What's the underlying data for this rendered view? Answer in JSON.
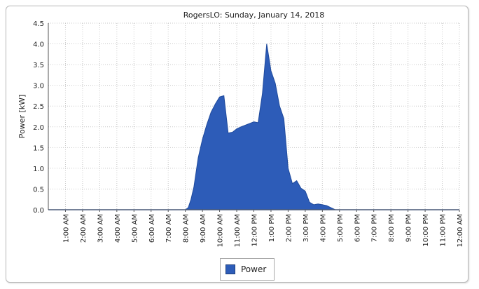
{
  "colors": {
    "series_fill": "#2d5cb8",
    "series_stroke": "#1f4a9c",
    "grid": "#c9c9c9",
    "axis": "#555555",
    "text": "#222222"
  },
  "chart_data": {
    "type": "area",
    "title": "RogersLO: Sunday, January 14, 2018",
    "xlabel": "",
    "ylabel": "Power [kW]",
    "ylim": [
      0,
      4.5
    ],
    "y_ticks": [
      "0.0",
      "0.5",
      "1.0",
      "1.5",
      "2.0",
      "2.5",
      "3.0",
      "3.5",
      "4.0",
      "4.5"
    ],
    "x_range_hours": [
      0,
      24
    ],
    "x_ticks": [
      {
        "hour": 1,
        "label": "1:00 AM"
      },
      {
        "hour": 2,
        "label": "2:00 AM"
      },
      {
        "hour": 3,
        "label": "3:00 AM"
      },
      {
        "hour": 4,
        "label": "4:00 AM"
      },
      {
        "hour": 5,
        "label": "5:00 AM"
      },
      {
        "hour": 6,
        "label": "6:00 AM"
      },
      {
        "hour": 7,
        "label": "7:00 AM"
      },
      {
        "hour": 8,
        "label": "8:00 AM"
      },
      {
        "hour": 9,
        "label": "9:00 AM"
      },
      {
        "hour": 10,
        "label": "10:00 AM"
      },
      {
        "hour": 11,
        "label": "11:00 AM"
      },
      {
        "hour": 12,
        "label": "12:00 PM"
      },
      {
        "hour": 13,
        "label": "1:00 PM"
      },
      {
        "hour": 14,
        "label": "2:00 PM"
      },
      {
        "hour": 15,
        "label": "3:00 PM"
      },
      {
        "hour": 16,
        "label": "4:00 PM"
      },
      {
        "hour": 17,
        "label": "5:00 PM"
      },
      {
        "hour": 18,
        "label": "6:00 PM"
      },
      {
        "hour": 19,
        "label": "7:00 PM"
      },
      {
        "hour": 20,
        "label": "8:00 PM"
      },
      {
        "hour": 21,
        "label": "9:00 PM"
      },
      {
        "hour": 22,
        "label": "10:00 PM"
      },
      {
        "hour": 23,
        "label": "11:00 PM"
      },
      {
        "hour": 24,
        "label": "12:00 AM"
      }
    ],
    "grid": true,
    "legend_position": "bottom-center",
    "series": [
      {
        "name": "Power",
        "points": [
          {
            "hour": 0.0,
            "kw": 0.0
          },
          {
            "hour": 8.0,
            "kw": 0.0
          },
          {
            "hour": 8.17,
            "kw": 0.05
          },
          {
            "hour": 8.33,
            "kw": 0.25
          },
          {
            "hour": 8.5,
            "kw": 0.55
          },
          {
            "hour": 8.75,
            "kw": 1.25
          },
          {
            "hour": 9.0,
            "kw": 1.7
          },
          {
            "hour": 9.25,
            "kw": 2.05
          },
          {
            "hour": 9.5,
            "kw": 2.35
          },
          {
            "hour": 9.75,
            "kw": 2.55
          },
          {
            "hour": 10.0,
            "kw": 2.72
          },
          {
            "hour": 10.25,
            "kw": 2.75
          },
          {
            "hour": 10.5,
            "kw": 1.85
          },
          {
            "hour": 10.75,
            "kw": 1.87
          },
          {
            "hour": 11.0,
            "kw": 1.95
          },
          {
            "hour": 11.25,
            "kw": 2.0
          },
          {
            "hour": 11.5,
            "kw": 2.04
          },
          {
            "hour": 11.75,
            "kw": 2.08
          },
          {
            "hour": 12.0,
            "kw": 2.12
          },
          {
            "hour": 12.25,
            "kw": 2.1
          },
          {
            "hour": 12.5,
            "kw": 2.8
          },
          {
            "hour": 12.75,
            "kw": 4.0
          },
          {
            "hour": 13.0,
            "kw": 3.35
          },
          {
            "hour": 13.25,
            "kw": 3.05
          },
          {
            "hour": 13.5,
            "kw": 2.5
          },
          {
            "hour": 13.75,
            "kw": 2.2
          },
          {
            "hour": 14.0,
            "kw": 1.0
          },
          {
            "hour": 14.25,
            "kw": 0.63
          },
          {
            "hour": 14.5,
            "kw": 0.7
          },
          {
            "hour": 14.75,
            "kw": 0.52
          },
          {
            "hour": 15.0,
            "kw": 0.45
          },
          {
            "hour": 15.25,
            "kw": 0.18
          },
          {
            "hour": 15.5,
            "kw": 0.12
          },
          {
            "hour": 15.75,
            "kw": 0.14
          },
          {
            "hour": 16.0,
            "kw": 0.12
          },
          {
            "hour": 16.25,
            "kw": 0.1
          },
          {
            "hour": 16.5,
            "kw": 0.05
          },
          {
            "hour": 16.75,
            "kw": 0.0
          },
          {
            "hour": 24.0,
            "kw": 0.0
          }
        ]
      }
    ]
  }
}
